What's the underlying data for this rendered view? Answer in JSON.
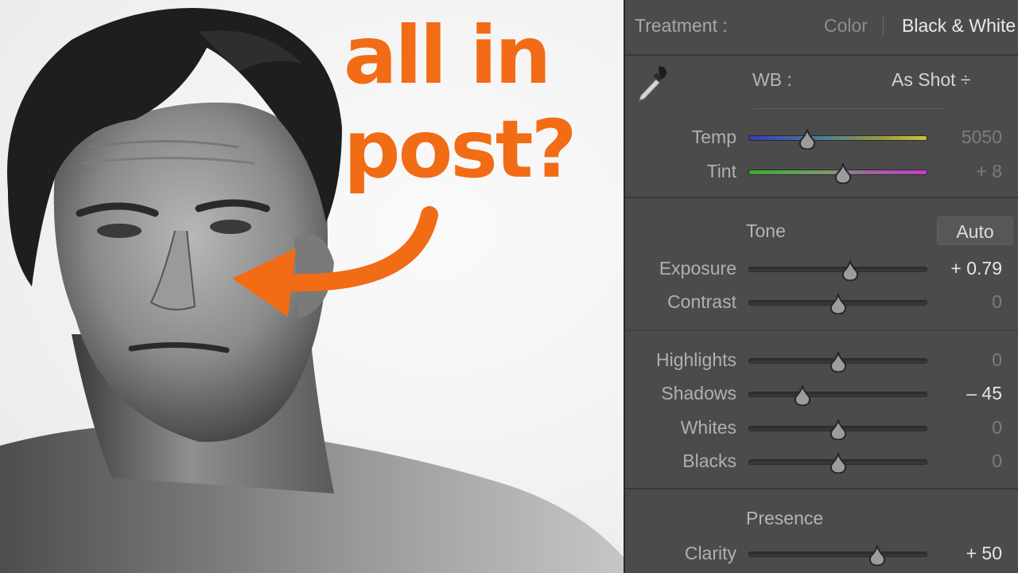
{
  "headline": {
    "line1": "all in",
    "line2": "post?",
    "color": "#f26b15"
  },
  "panel": {
    "treatment": {
      "label": "Treatment :",
      "options": [
        "Color",
        "Black & White"
      ],
      "selected": "Black & White"
    },
    "wb": {
      "tool_icon": "eyedropper-icon",
      "label": "WB :",
      "value": "As Shot ÷"
    },
    "wb_sliders": [
      {
        "label": "Temp",
        "value": "5050",
        "position": 0.33,
        "track": "temp"
      },
      {
        "label": "Tint",
        "value": "+ 8",
        "position": 0.53,
        "track": "tint"
      }
    ],
    "tone": {
      "title": "Tone",
      "auto_label": "Auto",
      "sliders": [
        {
          "label": "Exposure",
          "value": "+ 0.79",
          "position": 0.57,
          "changed": true
        },
        {
          "label": "Contrast",
          "value": "0",
          "position": 0.5,
          "changed": false
        }
      ],
      "sliders2": [
        {
          "label": "Highlights",
          "value": "0",
          "position": 0.5,
          "changed": false
        },
        {
          "label": "Shadows",
          "value": "– 45",
          "position": 0.3,
          "changed": true
        },
        {
          "label": "Whites",
          "value": "0",
          "position": 0.5,
          "changed": false
        },
        {
          "label": "Blacks",
          "value": "0",
          "position": 0.5,
          "changed": false
        }
      ]
    },
    "presence": {
      "title": "Presence",
      "sliders": [
        {
          "label": "Clarity",
          "value": "+ 50",
          "position": 0.72,
          "changed": true
        }
      ]
    }
  }
}
